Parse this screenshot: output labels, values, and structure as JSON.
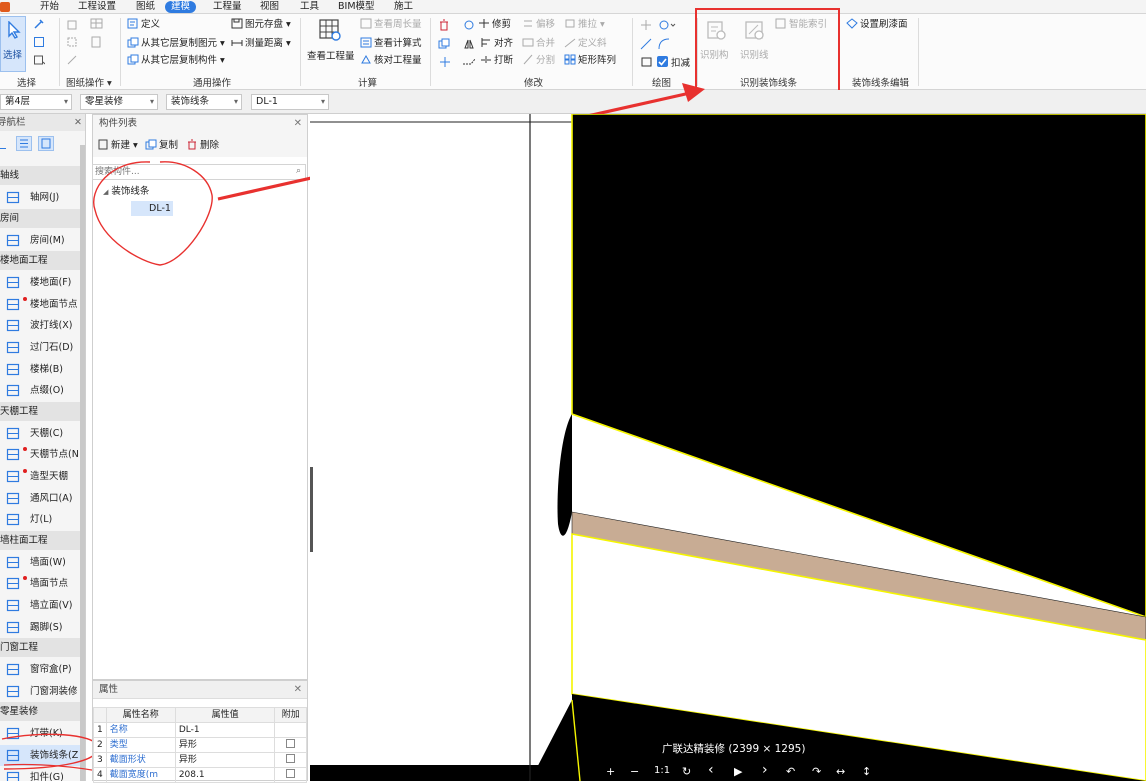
{
  "menu": {
    "items": [
      "开始",
      "工程设置",
      "图纸",
      "建模",
      "工程量",
      "视图",
      "工具",
      "BIM模型",
      "施工"
    ],
    "active": "建模"
  },
  "ribbon": {
    "select": {
      "button": "选择",
      "group": "选择"
    },
    "drawing_ops": {
      "group": "图纸操作 ▾"
    },
    "common_ops": {
      "define": "定义",
      "copy_elements": "从其它层复制图元 ▾",
      "copy_components": "从其它层复制构件 ▾",
      "element_save": "图元存盘 ▾",
      "measure_distance": "测量距离 ▾",
      "group": "通用操作"
    },
    "calc": {
      "view_quantity": "查看工程量",
      "view_perimeter": "查看周长量",
      "view_formula": "查看计算式",
      "check_quantity": "核对工程量",
      "group": "计算"
    },
    "modify": {
      "trim": "修剪",
      "offset": "偏移",
      "push_pull": "推拉 ▾",
      "align": "对齐",
      "merge": "合并",
      "define_slope": "定义斜",
      "break": "打断",
      "split": "分割",
      "rect_array": "矩形阵列",
      "group": "修改"
    },
    "draw": {
      "deduct": "扣减",
      "deduct_checked": true,
      "group": "绘图"
    },
    "identify": {
      "btn1": "识别构",
      "btn2": "识别线",
      "smart_index": "智能索引",
      "group": "识别装饰线条"
    },
    "edit": {
      "brush_face": "设置刷漆面",
      "group": "装饰线条编辑"
    }
  },
  "filters": {
    "floor": "第4层",
    "category": "零星装修",
    "type": "装饰线条",
    "component": "DL-1"
  },
  "nav": {
    "title": "导航栏",
    "sections": [
      {
        "label": "轴线",
        "items": [
          {
            "label": "轴网(J)",
            "icon": "grid-icon"
          }
        ]
      },
      {
        "label": "房间",
        "items": [
          {
            "label": "房间(M)",
            "icon": "house-icon"
          }
        ]
      },
      {
        "label": "楼地面工程",
        "items": [
          {
            "label": "楼地面(F)",
            "icon": "floor-icon"
          },
          {
            "label": "楼地面节点",
            "icon": "floor-node-icon",
            "dot": true
          },
          {
            "label": "波打线(X)",
            "icon": "border-line-icon"
          },
          {
            "label": "过门石(D)",
            "icon": "door-stone-icon"
          },
          {
            "label": "楼梯(B)",
            "icon": "stairs-icon"
          },
          {
            "label": "点缀(O)",
            "icon": "ornament-icon"
          }
        ]
      },
      {
        "label": "天棚工程",
        "items": [
          {
            "label": "天棚(C)",
            "icon": "ceiling-icon"
          },
          {
            "label": "天棚节点(N",
            "icon": "ceiling-node-icon",
            "dot": true
          },
          {
            "label": "造型天棚",
            "icon": "shaped-ceiling-icon",
            "dot": true
          },
          {
            "label": "通风口(A)",
            "icon": "vent-icon"
          },
          {
            "label": "灯(L)",
            "icon": "lamp-icon"
          }
        ]
      },
      {
        "label": "墙柱面工程",
        "items": [
          {
            "label": "墙面(W)",
            "icon": "wall-icon"
          },
          {
            "label": "墙面节点",
            "icon": "wall-node-icon",
            "dot": true
          },
          {
            "label": "墙立面(V)",
            "icon": "wall-elevation-icon"
          },
          {
            "label": "踢脚(S)",
            "icon": "skirting-icon"
          }
        ]
      },
      {
        "label": "门窗工程",
        "items": [
          {
            "label": "窗帘盒(P)",
            "icon": "curtain-box-icon"
          },
          {
            "label": "门窗洞装修",
            "icon": "door-window-icon"
          }
        ]
      },
      {
        "label": "零星装修",
        "items": [
          {
            "label": "灯带(K)",
            "icon": "light-strip-icon"
          },
          {
            "label": "装饰线条(Z",
            "icon": "molding-icon",
            "selected": true
          },
          {
            "label": "扣件(G)",
            "icon": "fastener-icon"
          }
        ]
      }
    ]
  },
  "component_list": {
    "title": "构件列表",
    "new": "新建 ▾",
    "copy": "复制",
    "delete": "删除",
    "search_placeholder": "搜索构件...",
    "tree": {
      "group": "装饰线条",
      "items": [
        "DL-1"
      ]
    }
  },
  "properties": {
    "title": "属性",
    "headers": [
      "属性名称",
      "属性值",
      "附加"
    ],
    "rows": [
      {
        "num": "1",
        "name": "名称",
        "value": "DL-1",
        "extra": false,
        "has_check": false
      },
      {
        "num": "2",
        "name": "类型",
        "value": "异形",
        "extra": false,
        "has_check": true
      },
      {
        "num": "3",
        "name": "截面形状",
        "value": "异形",
        "extra": false,
        "has_check": true
      },
      {
        "num": "4",
        "name": "截面宽度(m",
        "value": "208.1",
        "extra": false,
        "has_check": true
      }
    ]
  },
  "viewer": {
    "caption": "广联达精装修 (2399 × 1295)",
    "controls": [
      "+",
      "−",
      "1:1",
      "↻",
      "‹",
      "▶",
      "›",
      "↶",
      "↷",
      "↔",
      "↕"
    ]
  },
  "colors": {
    "accent": "#2f7be0",
    "annotation_red": "#e8312f",
    "molding_fill": "#c8ac94",
    "outline_yellow": "#f5f500"
  }
}
